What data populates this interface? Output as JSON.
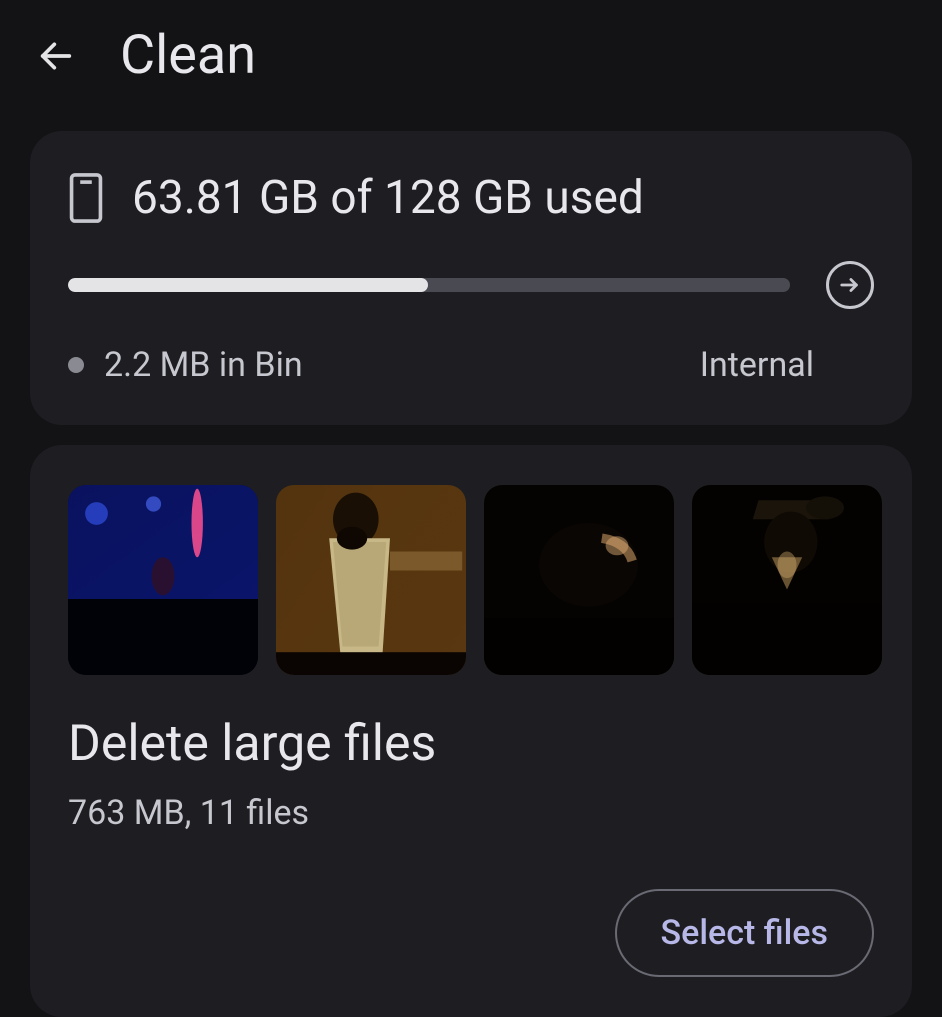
{
  "header": {
    "title": "Clean"
  },
  "storage": {
    "usage_text": "63.81 GB of 128 GB used",
    "progress_percent": 49.85,
    "bin_text": "2.2 MB in Bin",
    "location_text": "Internal"
  },
  "large_files": {
    "title": "Delete large files",
    "subtitle": "763 MB, 11 files",
    "action_label": "Select files",
    "thumbnails": [
      {
        "name": "thumb-concert-blue"
      },
      {
        "name": "thumb-concert-amber"
      },
      {
        "name": "thumb-concert-dark"
      },
      {
        "name": "thumb-concert-cap"
      }
    ]
  }
}
